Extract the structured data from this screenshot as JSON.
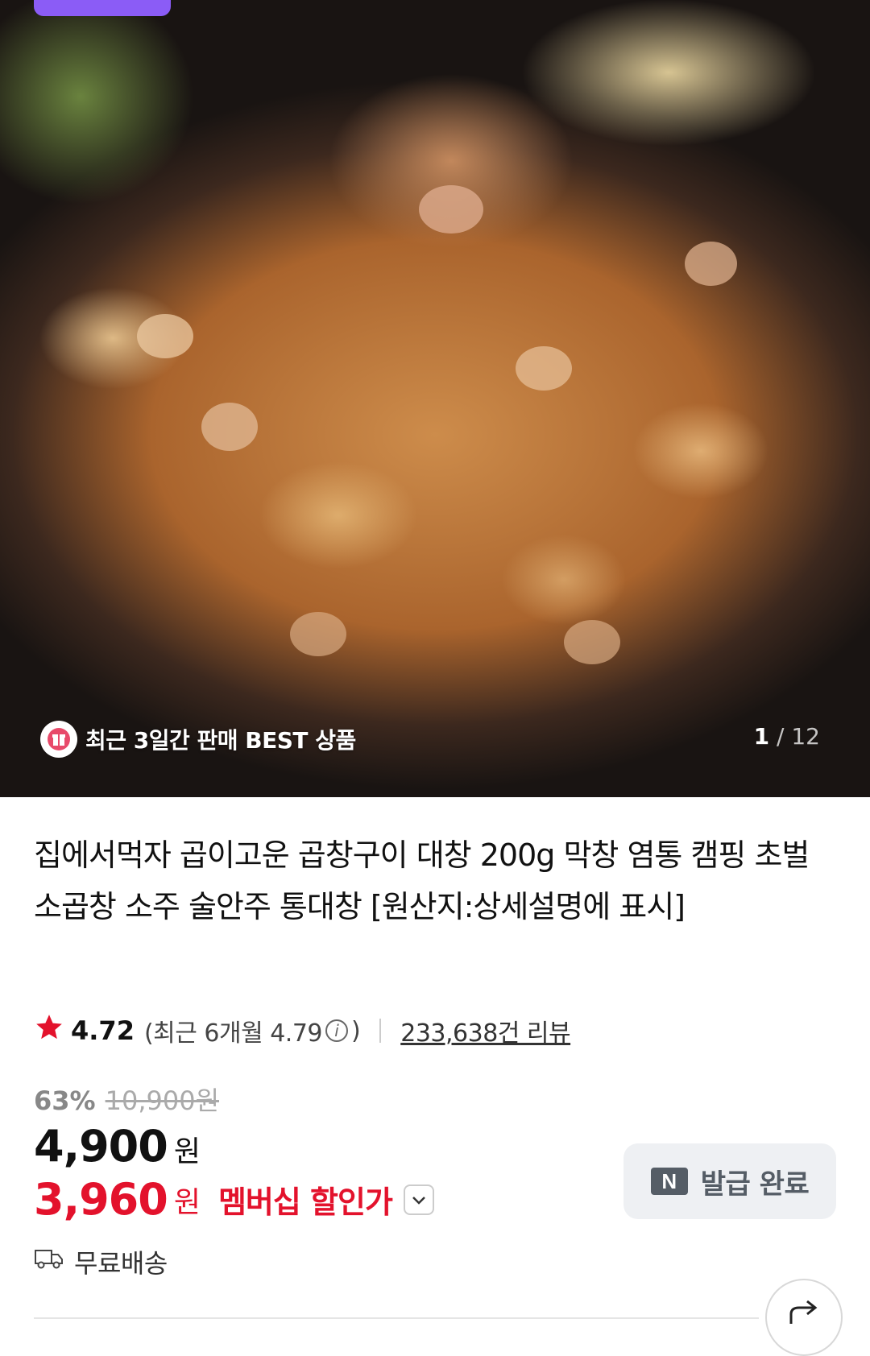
{
  "hero": {
    "badge_text": "최근 3일간 판매 BEST 상품",
    "page_current": "1",
    "page_sep": "/",
    "page_total": "12"
  },
  "product": {
    "title": "집에서먹자 곱이고운 곱창구이 대창 200g 막창 염통 캠핑 초벌 소곱창 소주 술안주 통대창 [원산지:상세설명에 표시]"
  },
  "rating": {
    "score": "4.72",
    "recent_prefix": "(최근 6개월 4.79",
    "recent_suffix": ")",
    "reviews": "233,638건 리뷰",
    "star_color": "#e3122c"
  },
  "price": {
    "discount": "63%",
    "original": "10,900원",
    "sale": "4,900",
    "sale_unit": "원",
    "member_price": "3,960",
    "member_unit": "원",
    "member_label": "멤버십 할인가",
    "member_color": "#e3122c"
  },
  "coupon": {
    "logo": "N",
    "label": "발급 완료"
  },
  "shipping": {
    "label": "무료배송"
  },
  "icons": {
    "best": "gift-icon",
    "star": "star-icon",
    "info": "info-icon",
    "toggle": "chevron-down-icon",
    "truck": "truck-icon",
    "share": "share-icon"
  }
}
